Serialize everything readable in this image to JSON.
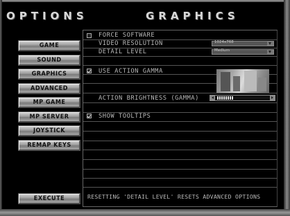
{
  "header": {
    "left_title": "OPTIONS",
    "right_title": "GRAPHICS"
  },
  "sidebar": {
    "items": [
      {
        "label": "GAME"
      },
      {
        "label": "SOUND"
      },
      {
        "label": "GRAPHICS"
      },
      {
        "label": "ADVANCED"
      },
      {
        "label": "MP GAME"
      },
      {
        "label": "MP SERVER"
      },
      {
        "label": "JOYSTICK"
      },
      {
        "label": "REMAP KEYS"
      }
    ],
    "execute_label": "EXECUTE"
  },
  "graphics": {
    "force_software": {
      "label": "FORCE SOFTWARE",
      "checked": false
    },
    "video_resolution": {
      "label": "VIDEO RESOLUTION",
      "value": "1024x768"
    },
    "detail_level": {
      "label": "DETAIL LEVEL",
      "value": "Medium"
    },
    "use_action_gamma": {
      "label": "USE ACTION GAMMA",
      "checked": true
    },
    "action_brightness": {
      "label": "ACTION BRIGHTNESS (GAMMA)",
      "level": 0.3
    },
    "show_tooltips": {
      "label": "SHOW TOOLTIPS",
      "checked": true
    },
    "footer_note": "RESETTING 'DETAIL LEVEL' RESETS ADVANCED OPTIONS"
  }
}
